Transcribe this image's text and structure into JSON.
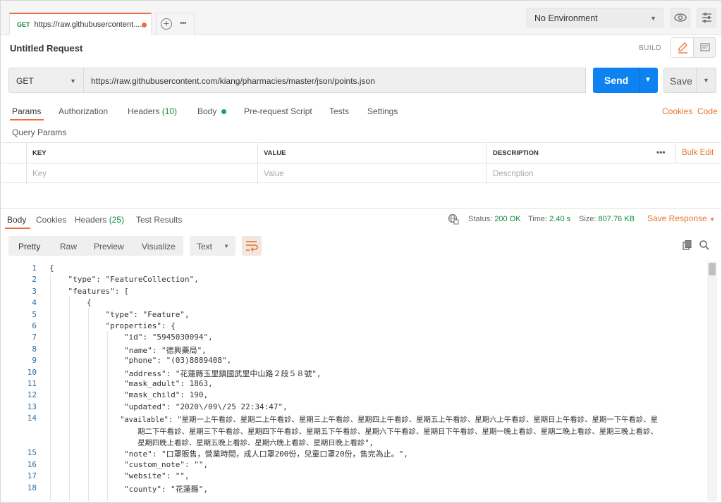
{
  "tabs": [
    {
      "method": "GET",
      "url": "https://raw.githubusercontent...."
    }
  ],
  "environment": {
    "selected": "No Environment"
  },
  "request": {
    "title": "Untitled Request",
    "build_label": "BUILD",
    "method": "GET",
    "url": "https://raw.githubusercontent.com/kiang/pharmacies/master/json/points.json",
    "send_label": "Send",
    "save_label": "Save"
  },
  "request_tabs": {
    "params": "Params",
    "authorization": "Authorization",
    "headers": "Headers",
    "headers_count": "(10)",
    "body": "Body",
    "pre_request": "Pre-request Script",
    "tests": "Tests",
    "settings": "Settings",
    "cookies": "Cookies",
    "code": "Code"
  },
  "query_params": {
    "title": "Query Params",
    "headers": {
      "key": "KEY",
      "value": "VALUE",
      "description": "DESCRIPTION",
      "bulk_edit": "Bulk Edit"
    },
    "placeholder": {
      "key": "Key",
      "value": "Value",
      "description": "Description"
    }
  },
  "response": {
    "tabs": {
      "body": "Body",
      "cookies": "Cookies",
      "headers": "Headers",
      "headers_count": "(25)",
      "test_results": "Test Results"
    },
    "status_label": "Status:",
    "status_value": "200 OK",
    "time_label": "Time:",
    "time_value": "2.40 s",
    "size_label": "Size:",
    "size_value": "807.76 KB",
    "save_response": "Save Response",
    "format_tabs": [
      "Pretty",
      "Raw",
      "Preview",
      "Visualize"
    ],
    "format_selected": "Pretty",
    "text_type": "Text"
  },
  "code_lines": [
    {
      "n": "1",
      "t": "{"
    },
    {
      "n": "2",
      "t": "    \"type\": \"FeatureCollection\","
    },
    {
      "n": "3",
      "t": "    \"features\": ["
    },
    {
      "n": "4",
      "t": "        {"
    },
    {
      "n": "5",
      "t": "            \"type\": \"Feature\","
    },
    {
      "n": "6",
      "t": "            \"properties\": {"
    },
    {
      "n": "7",
      "t": "                \"id\": \"5945030094\","
    },
    {
      "n": "8",
      "t": "                \"name\": \"德興藥局\","
    },
    {
      "n": "9",
      "t": "                \"phone\": \"(03)8889408\","
    },
    {
      "n": "10",
      "t": "                \"address\": \"花蓮縣玉里鎮國武里中山路２段５８號\","
    },
    {
      "n": "11",
      "t": "                \"mask_adult\": 1863,"
    },
    {
      "n": "12",
      "t": "                \"mask_child\": 190,"
    },
    {
      "n": "13",
      "t": "                \"updated\": \"2020\\/09\\/25 22:34:47\","
    },
    {
      "n": "14",
      "t": "                \"available\": \"星期一上午看診、星期二上午看診、星期三上午看診、星期四上午看診、星期五上午看診、星期六上午看診、星期日上午看診、星期一下午看診、星"
    },
    {
      "n": "",
      "t": "                    期二下午看診、星期三下午看診、星期四下午看診、星期五下午看診、星期六下午看診、星期日下午看診、星期一晚上看診、星期二晚上看診、星期三晚上看診、"
    },
    {
      "n": "",
      "t": "                    星期四晚上看診、星期五晚上看診、星期六晚上看診、星期日晚上看診\","
    },
    {
      "n": "15",
      "t": "                \"note\": \"口罩販售，營業時間，成人口罩200份，兒童口罩20份，售完為止。\","
    },
    {
      "n": "16",
      "t": "                \"custom_note\": \"\","
    },
    {
      "n": "17",
      "t": "                \"website\": \"\","
    },
    {
      "n": "18",
      "t": "                \"county\": \"花蓮縣\","
    }
  ]
}
